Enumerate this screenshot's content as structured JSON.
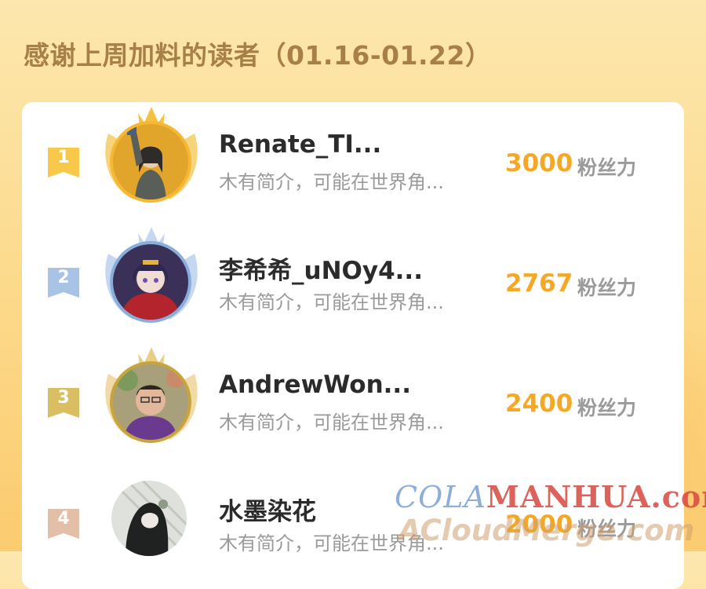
{
  "heading": "感谢上周加料的读者（01.16-01.22）",
  "unit_label": "粉丝力",
  "readers": [
    {
      "rank": "1",
      "name": "Renate_TI...",
      "bio": "木有简介，可能在世界角...",
      "points": "3000",
      "rank_color": "#f7c84a",
      "ring_color": "#f6b733"
    },
    {
      "rank": "2",
      "name": "李希希_uNOy4...",
      "bio": "木有简介，可能在世界角...",
      "points": "2767",
      "rank_color": "#a9c3e6",
      "ring_color": "#8aaedc"
    },
    {
      "rank": "3",
      "name": "AndrewWon...",
      "bio": "木有简介，可能在世界角...",
      "points": "2400",
      "rank_color": "#dbbd62",
      "ring_color": "#c9a43c"
    },
    {
      "rank": "4",
      "name": "水墨染花",
      "bio": "木有简介，可能在世界角...",
      "points": "2000",
      "rank_color": "#e3bfa8",
      "ring_color": "#e3bfa8"
    }
  ],
  "watermark": {
    "line1_part1": "COLA",
    "line1_part2": "MANHUA.com",
    "line2": "ACloudMerge.com"
  }
}
